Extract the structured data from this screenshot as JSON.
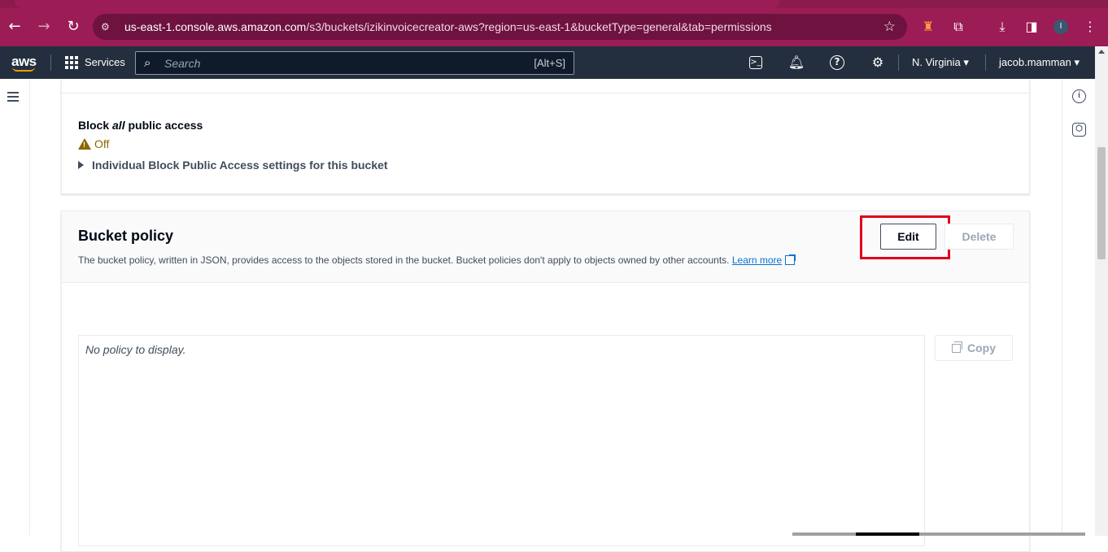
{
  "browser": {
    "url_host": "us-east-1.console.aws.amazon.com",
    "url_path": "/s3/buckets/izikinvoicecreator-aws?region=us-east-1&bucketType=general&tab=permissions",
    "profile_initial": "I",
    "icons": [
      "back-arrow-icon",
      "forward-arrow-icon",
      "reload-icon",
      "site-info-icon",
      "star-icon",
      "extension-icon",
      "puzzle-icon",
      "download-icon",
      "sidebar-icon",
      "menu-dots-icon"
    ]
  },
  "aws_nav": {
    "logo": "aws",
    "services_label": "Services",
    "search_placeholder": "Search",
    "search_shortcut": "[Alt+S]",
    "region": "N. Virginia",
    "user": "jacob.mamman"
  },
  "block_public_access": {
    "title_prefix": "Block ",
    "title_emphasis": "all",
    "title_suffix": " public access",
    "status": "Off",
    "expander_label": "Individual Block Public Access settings for this bucket"
  },
  "bucket_policy": {
    "title": "Bucket policy",
    "description": "The bucket policy, written in JSON, provides access to the objects stored in the bucket. Bucket policies don't apply to objects owned by other accounts.",
    "learn_more": "Learn more",
    "edit_label": "Edit",
    "delete_label": "Delete",
    "empty_text": "No policy to display.",
    "copy_label": "Copy"
  },
  "colors": {
    "browser_frame": "#9c1c56",
    "aws_nav": "#232f3e",
    "warning": "#8d6605",
    "link": "#0972d3",
    "highlight": "#e0001b"
  }
}
